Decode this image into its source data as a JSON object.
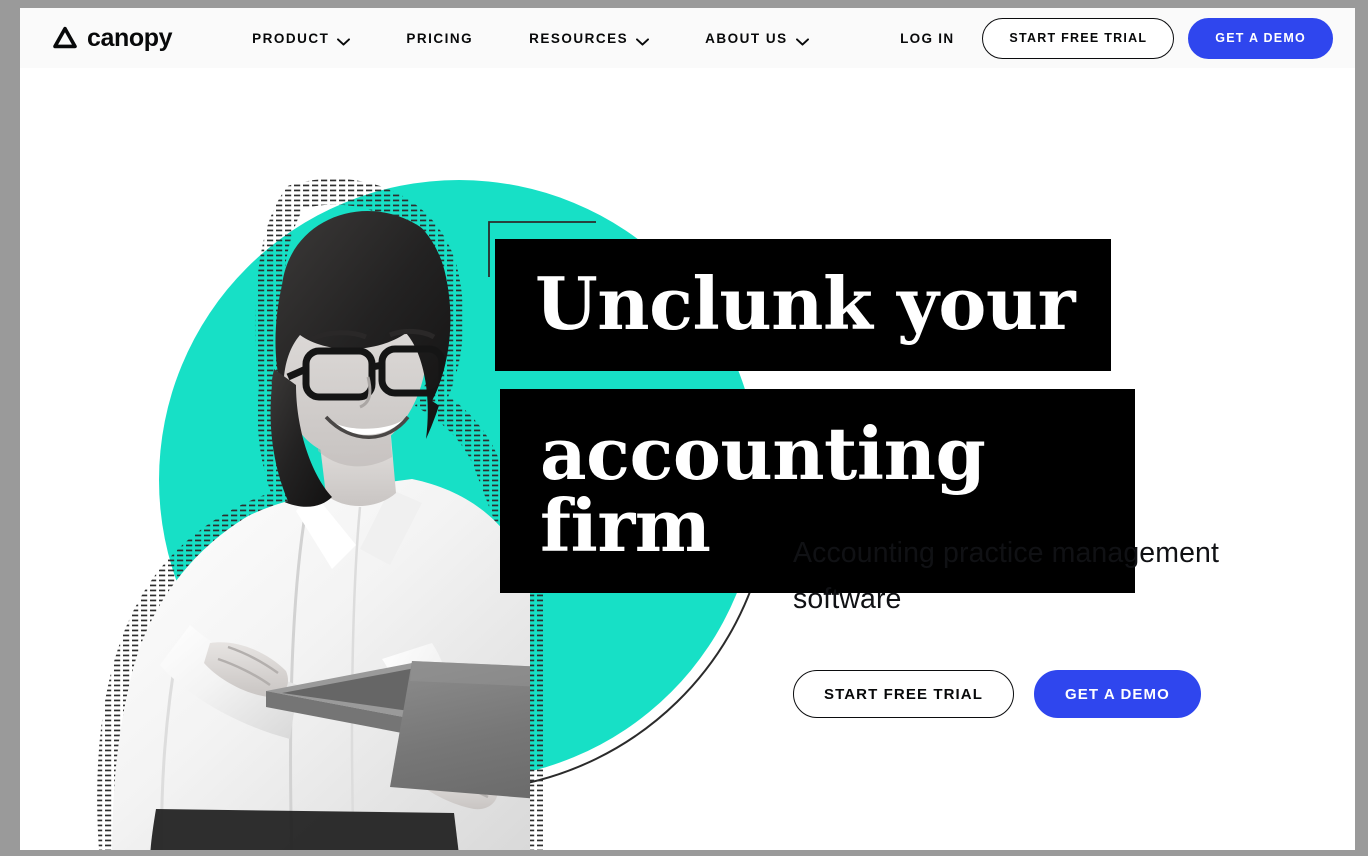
{
  "brand": {
    "name": "canopy",
    "logo_icon": "canopy-triangle-logo-icon"
  },
  "nav": {
    "items": [
      {
        "label": "PRODUCT",
        "has_dropdown": true,
        "icon": "chevron-down-icon"
      },
      {
        "label": "PRICING",
        "has_dropdown": false,
        "icon": ""
      },
      {
        "label": "RESOURCES",
        "has_dropdown": true,
        "icon": "chevron-down-icon"
      },
      {
        "label": "ABOUT US",
        "has_dropdown": true,
        "icon": "chevron-down-icon"
      }
    ],
    "login_label": "LOG IN",
    "trial_label": "START FREE TRIAL",
    "demo_label": "GET A DEMO"
  },
  "hero": {
    "headline_line_1": "Unclunk your",
    "headline_line_2": "accounting firm",
    "subtitle": "Accounting practice management software",
    "trial_label": "START FREE TRIAL",
    "demo_label": "GET A DEMO",
    "image_alt": "Smiling woman with glasses holding an open laptop"
  },
  "colors": {
    "accent_blue": "#2f46ee",
    "accent_teal": "#17e0c6",
    "headline_band": "#000000",
    "nav_background": "#fafafa",
    "page_background": "#ffffff",
    "browser_chrome": "#9a9a9a",
    "text_primary": "#08090a"
  }
}
